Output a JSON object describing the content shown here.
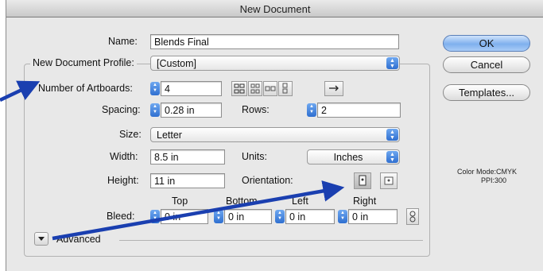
{
  "window": {
    "title": "New Document"
  },
  "form": {
    "name_label": "Name:",
    "name_value": "Blends Final",
    "profile_label": "New Document Profile:",
    "profile_value": "[Custom]",
    "artboards_label": "Number of Artboards:",
    "artboards_value": "4",
    "spacing_label": "Spacing:",
    "spacing_value": "0.28 in",
    "rows_label": "Rows:",
    "rows_value": "2",
    "size_label": "Size:",
    "size_value": "Letter",
    "width_label": "Width:",
    "width_value": "8.5 in",
    "units_label": "Units:",
    "units_value": "Inches",
    "height_label": "Height:",
    "height_value": "11 in",
    "orientation_label": "Orientation:",
    "bleed_label": "Bleed:",
    "bleed_top_label": "Top",
    "bleed_bottom_label": "Bottom",
    "bleed_left_label": "Left",
    "bleed_right_label": "Right",
    "bleed_top": "0 in",
    "bleed_bottom": "0 in",
    "bleed_left": "0 in",
    "bleed_right": "0 in",
    "advanced_label": "Advanced"
  },
  "buttons": {
    "ok": "OK",
    "cancel": "Cancel",
    "templates": "Templates..."
  },
  "info": {
    "color_mode": "Color Mode:CMYK",
    "ppi": "PPI:300"
  },
  "icons": [
    "grid-by-row-icon",
    "grid-by-column-icon",
    "arrange-by-row-icon",
    "arrange-by-column-icon",
    "arrow-right-icon",
    "portrait-icon",
    "landscape-icon",
    "link-icon",
    "disclosure-triangle-icon"
  ],
  "colors": {
    "accent": "#2f6fd0",
    "annotation_arrow": "#1a3fb0",
    "dialog_bg": "#e8e8e8"
  }
}
